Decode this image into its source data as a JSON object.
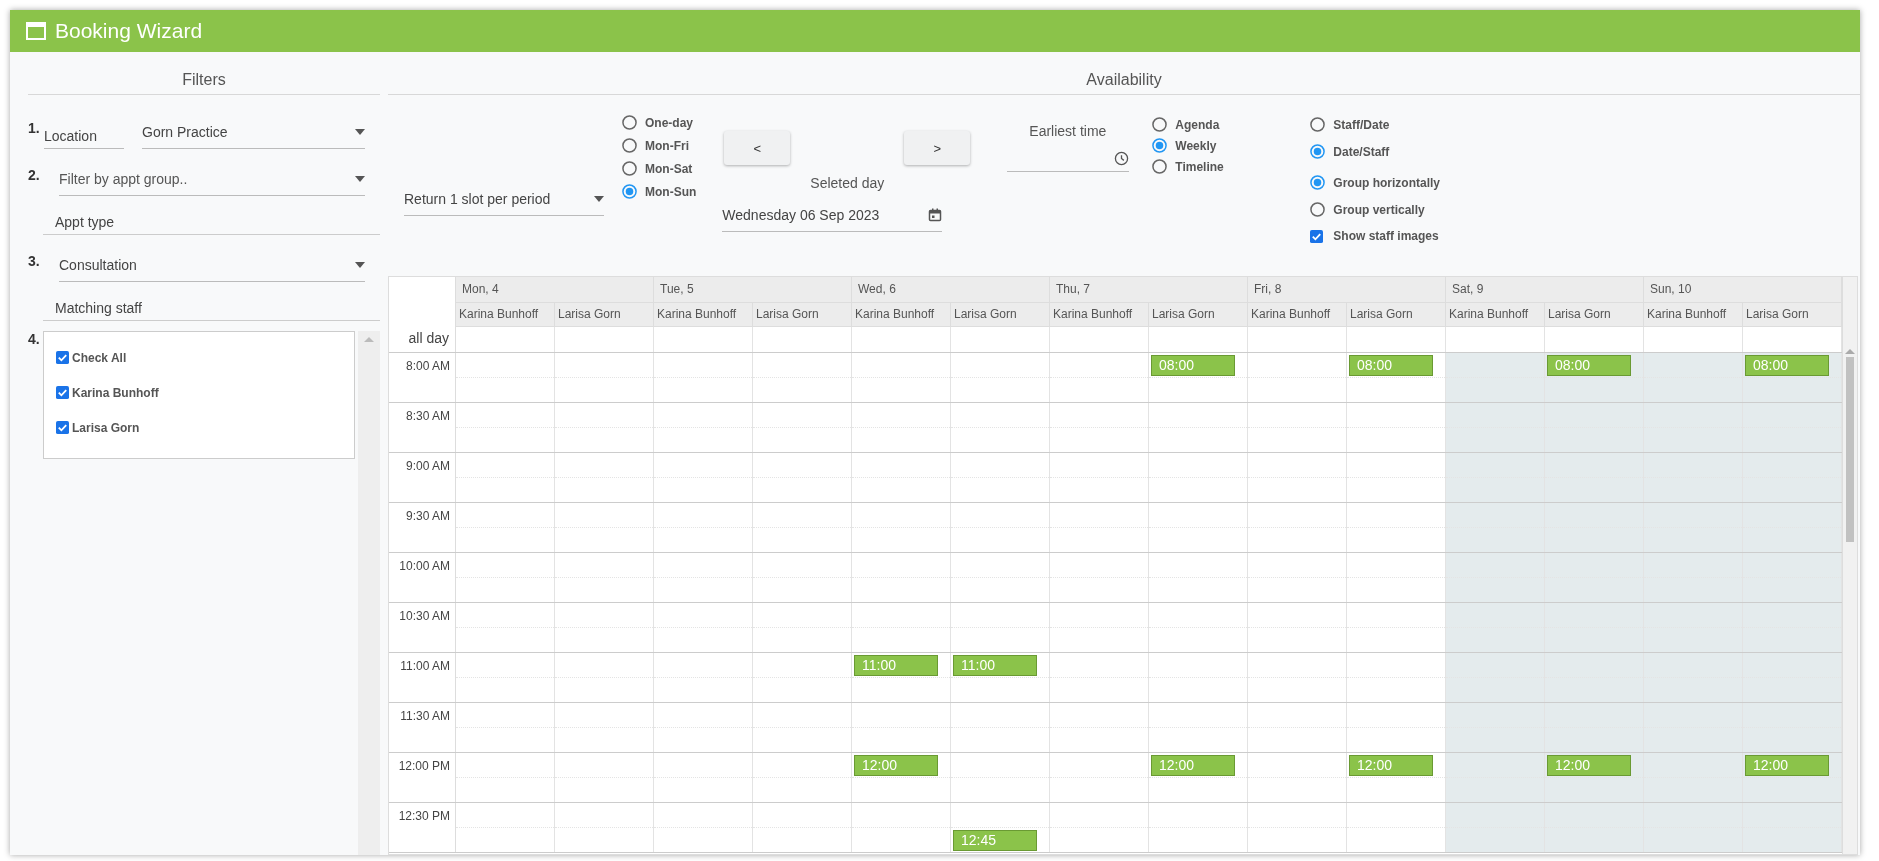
{
  "window": {
    "title": "Booking Wizard"
  },
  "filters": {
    "heading": "Filters",
    "location": {
      "number": "1.",
      "label": "Location",
      "value": "Gorn Practice"
    },
    "appt_group": {
      "number": "2.",
      "placeholder": "Filter by appt group.."
    },
    "appt_type": {
      "label": "Appt type",
      "number": "3.",
      "value": "Consultation"
    },
    "matching_staff": {
      "label": "Matching staff",
      "number": "4.",
      "items": [
        {
          "label": "Check All",
          "checked": true
        },
        {
          "label": "Karina Bunhoff",
          "checked": true
        },
        {
          "label": "Larisa Gorn",
          "checked": true
        }
      ]
    }
  },
  "availability": {
    "heading": "Availability",
    "slot_mode": {
      "value": "Return 1 slot per period"
    },
    "range_options": [
      {
        "label": "One-day",
        "selected": false
      },
      {
        "label": "Mon-Fri",
        "selected": false
      },
      {
        "label": "Mon-Sat",
        "selected": false
      },
      {
        "label": "Mon-Sun",
        "selected": true
      }
    ],
    "prev_button": "<",
    "next_button": ">",
    "selected_day": {
      "label": "Seleted day",
      "value": "Wednesday 06 Sep 2023"
    },
    "earliest_time": {
      "label": "Earliest time"
    },
    "view_options": [
      {
        "label": "Agenda",
        "selected": false
      },
      {
        "label": "Weekly",
        "selected": true
      },
      {
        "label": "Timeline",
        "selected": false
      }
    ],
    "order_options": [
      {
        "label": "Staff/Date",
        "selected": false
      },
      {
        "label": "Date/Staff",
        "selected": true
      }
    ],
    "group_options": [
      {
        "label": "Group horizontally",
        "selected": true
      },
      {
        "label": "Group vertically",
        "selected": false
      }
    ],
    "show_staff_images": {
      "label": "Show staff images",
      "checked": true
    },
    "calendar": {
      "days": [
        {
          "label": "Mon, 4",
          "weekend": false,
          "staff": [
            "Karina Bunhoff",
            "Larisa Gorn"
          ]
        },
        {
          "label": "Tue, 5",
          "weekend": false,
          "staff": [
            "Karina Bunhoff",
            "Larisa Gorn"
          ]
        },
        {
          "label": "Wed, 6",
          "weekend": false,
          "staff": [
            "Karina Bunhoff",
            "Larisa Gorn"
          ]
        },
        {
          "label": "Thu, 7",
          "weekend": false,
          "staff": [
            "Karina Bunhoff",
            "Larisa Gorn"
          ]
        },
        {
          "label": "Fri, 8",
          "weekend": false,
          "staff": [
            "Karina Bunhoff",
            "Larisa Gorn"
          ]
        },
        {
          "label": "Sat, 9",
          "weekend": true,
          "staff": [
            "Karina Bunhoff",
            "Larisa Gorn"
          ]
        },
        {
          "label": "Sun, 10",
          "weekend": true,
          "staff": [
            "Karina Bunhoff",
            "Larisa Gorn"
          ]
        }
      ],
      "all_day_label": "all day",
      "rows": [
        {
          "time": "8:00 AM",
          "cells": [
            {},
            {},
            {},
            {},
            {},
            {},
            {},
            {
              "first_half": "08:00"
            },
            {},
            {
              "first_half": "08:00"
            },
            {},
            {
              "first_half": "08:00"
            },
            {},
            {
              "first_half": "08:00"
            }
          ]
        },
        {
          "time": "8:30 AM",
          "cells": [
            {},
            {},
            {},
            {},
            {},
            {},
            {},
            {},
            {},
            {},
            {},
            {},
            {},
            {}
          ]
        },
        {
          "time": "9:00 AM",
          "cells": [
            {},
            {},
            {},
            {},
            {},
            {},
            {},
            {},
            {},
            {},
            {},
            {},
            {},
            {}
          ]
        },
        {
          "time": "9:30 AM",
          "cells": [
            {},
            {},
            {},
            {},
            {},
            {},
            {},
            {},
            {},
            {},
            {},
            {},
            {},
            {}
          ]
        },
        {
          "time": "10:00 AM",
          "cells": [
            {},
            {},
            {},
            {},
            {},
            {},
            {},
            {},
            {},
            {},
            {},
            {},
            {},
            {}
          ]
        },
        {
          "time": "10:30 AM",
          "cells": [
            {},
            {},
            {},
            {},
            {},
            {},
            {},
            {},
            {},
            {},
            {},
            {},
            {},
            {}
          ]
        },
        {
          "time": "11:00 AM",
          "cells": [
            {},
            {},
            {},
            {},
            {
              "first_half": "11:00"
            },
            {
              "first_half": "11:00"
            },
            {},
            {},
            {},
            {},
            {},
            {},
            {},
            {}
          ]
        },
        {
          "time": "11:30 AM",
          "cells": [
            {},
            {},
            {},
            {},
            {},
            {},
            {},
            {},
            {},
            {},
            {},
            {},
            {},
            {}
          ]
        },
        {
          "time": "12:00 PM",
          "cells": [
            {},
            {},
            {},
            {},
            {
              "first_half": "12:00"
            },
            {},
            {},
            {
              "first_half": "12:00"
            },
            {},
            {
              "first_half": "12:00"
            },
            {},
            {
              "first_half": "12:00"
            },
            {},
            {
              "first_half": "12:00"
            }
          ]
        },
        {
          "time": "12:30 PM",
          "cells": [
            {},
            {},
            {},
            {},
            {},
            {
              "second_half": "12:45"
            },
            {},
            {},
            {},
            {},
            {},
            {},
            {},
            {}
          ]
        }
      ]
    }
  }
}
